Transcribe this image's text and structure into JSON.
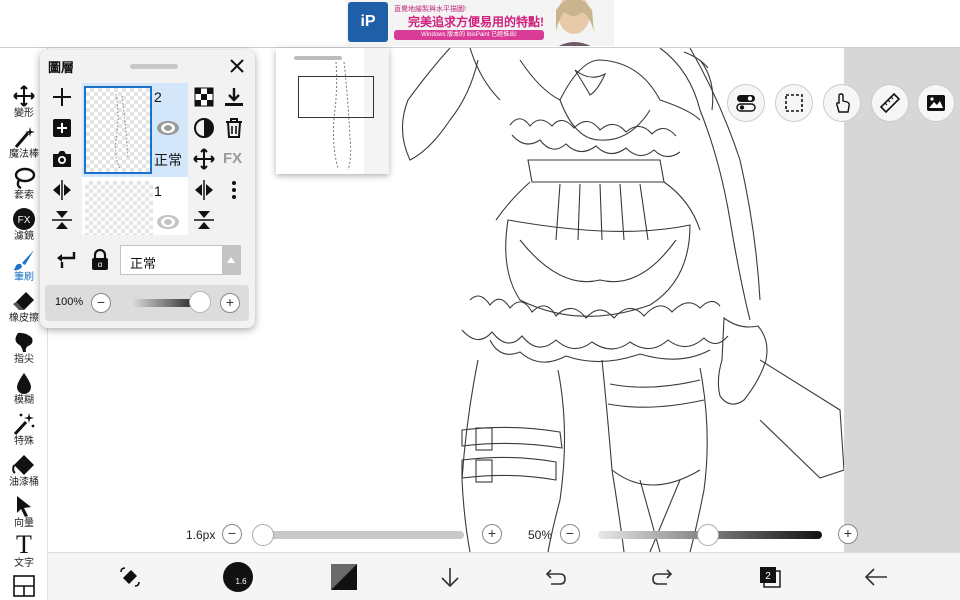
{
  "banner": {
    "ad_logo": "iP",
    "ad_line1": "直覺地繪製與水平描圖!",
    "ad_line2": "完美追求方便易用的特點!",
    "ad_line3": "Windows 版本的 ibisPaint 已經推出!"
  },
  "left_toolbar": {
    "tools": [
      {
        "label": "變形",
        "icon": "transform-icon"
      },
      {
        "label": "魔法棒",
        "icon": "magic-wand-icon"
      },
      {
        "label": "套索",
        "icon": "lasso-icon"
      },
      {
        "label": "濾鏡",
        "icon": "fx-icon",
        "badge": "FX"
      },
      {
        "label": "筆刷",
        "icon": "brush-icon",
        "active": true
      },
      {
        "label": "橡皮擦",
        "icon": "eraser-icon"
      },
      {
        "label": "指尖",
        "icon": "finger-icon"
      },
      {
        "label": "模糊",
        "icon": "blur-drop-icon"
      },
      {
        "label": "特殊",
        "icon": "special-sparkle-icon"
      },
      {
        "label": "油漆桶",
        "icon": "bucket-icon"
      },
      {
        "label": "向量",
        "icon": "vector-cursor-icon"
      },
      {
        "label": "文字",
        "icon": "text-icon",
        "glyph": "T"
      }
    ]
  },
  "layer_panel": {
    "title": "圖層",
    "layers": [
      {
        "number": "2",
        "blend": "正常",
        "selected": true
      },
      {
        "number": "1",
        "selected": false
      }
    ],
    "side_fx_label": "FX",
    "blend_mode_value": "正常",
    "opacity_value": "100%",
    "opacity_fraction": 1.0
  },
  "sliders": {
    "brush_size": {
      "label": "1.6px",
      "value_fraction": 0.0
    },
    "brush_opacity": {
      "label": "50%",
      "value_fraction": 0.5
    }
  },
  "bottom_bar": {
    "brush_size_badge": "1.6",
    "layer_count": "2"
  },
  "colors": {
    "accent": "#1a73c8",
    "selected_layer_bg": "#d4e6fa",
    "panel_bg": "#f2f2f2"
  }
}
